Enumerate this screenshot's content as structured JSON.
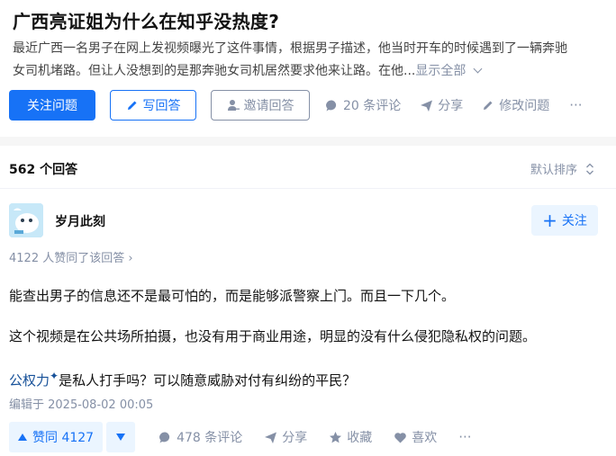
{
  "question": {
    "title": "广西亮证姐为什么在知乎没热度?",
    "description_line1": "最近广西一名男子在网上发视频曝光了这件事情，根据男子描述，他当时开车的时候遇到了一辆奔驰",
    "description_line2": "女司机堵路。但让人没想到的是那奔驰女司机居然要求他来让路。在他...",
    "show_all": "显示全部"
  },
  "actions": {
    "follow_question": "关注问题",
    "write_answer": "写回答",
    "invite_answer": "邀请回答",
    "comments": "20 条评论",
    "share": "分享",
    "edit_question": "修改问题",
    "more": "···"
  },
  "answers_header": {
    "count": "562 个回答",
    "sort": "默认排序"
  },
  "answer": {
    "author": "岁月此刻",
    "follow": "关注",
    "agree_line": "4122 人赞同了该回答 ›",
    "para1": "能查出男子的信息还不是最可怕的，而是能够派警察上门。而且一下几个。",
    "para2": "这个视频是在公共场所拍摄，也没有用于商业用途，明显的没有什么侵犯隐私权的问题。",
    "para3_keyword": "公权力",
    "para3_rest": "是私人打手吗？可以随意威胁对付有纠纷的平民？",
    "edit_time": "编辑于 2025-08-02 00:05",
    "vote_label": "赞同 4127",
    "comments": "478 条评论",
    "share": "分享",
    "collect": "收藏",
    "like": "喜欢",
    "more": "···"
  },
  "colors": {
    "primary": "#1772f6",
    "muted": "#8590a6",
    "vote_bg": "#ebf5ff",
    "keyword": "#175199"
  }
}
